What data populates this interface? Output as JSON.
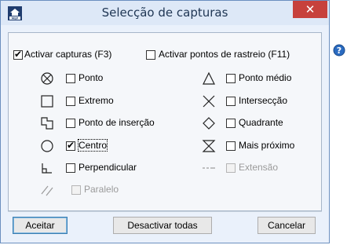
{
  "window": {
    "title": "Selecção de capturas",
    "close_glyph": "✕",
    "app_icon": "mep-app-icon"
  },
  "help_icon": "help-icon",
  "top_options": [
    {
      "label": "Activar capturas (F3)",
      "checked": true
    },
    {
      "label": "Activar pontos de rastreio (F11)",
      "checked": false
    }
  ],
  "snaps_left": [
    {
      "label": "Ponto",
      "checked": false,
      "enabled": true,
      "icon": "point-icon"
    },
    {
      "label": "Extremo",
      "checked": false,
      "enabled": true,
      "icon": "endpoint-icon"
    },
    {
      "label": "Ponto de inserção",
      "checked": false,
      "enabled": true,
      "icon": "insertion-icon"
    },
    {
      "label": "Centro",
      "checked": true,
      "enabled": true,
      "icon": "center-icon"
    },
    {
      "label": "Perpendicular",
      "checked": false,
      "enabled": true,
      "icon": "perpendicular-icon"
    },
    {
      "label": "Paralelo",
      "checked": false,
      "enabled": false,
      "icon": "parallel-icon"
    }
  ],
  "snaps_right": [
    {
      "label": "Ponto médio",
      "checked": false,
      "enabled": true,
      "icon": "midpoint-icon"
    },
    {
      "label": "Intersecção",
      "checked": false,
      "enabled": true,
      "icon": "intersection-icon"
    },
    {
      "label": "Quadrante",
      "checked": false,
      "enabled": true,
      "icon": "quadrant-icon"
    },
    {
      "label": "Mais próximo",
      "checked": false,
      "enabled": true,
      "icon": "nearest-icon"
    },
    {
      "label": "Extensão",
      "checked": false,
      "enabled": false,
      "icon": "extension-icon"
    }
  ],
  "buttons": {
    "accept": "Aceitar",
    "deactivate_all": "Desactivar todas",
    "cancel": "Cancelar"
  }
}
